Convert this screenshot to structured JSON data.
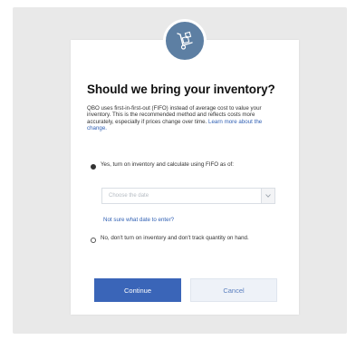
{
  "dialog": {
    "title": "Should we bring your inventory?",
    "description": "QBO uses first-in-first-out (FIFO) instead of average cost to value your inventory. This is the recommended method and reflects costs more accurately, especially if prices change over time.",
    "learn_more_link": "Learn more about the change.",
    "hero_icon": "hand-truck-boxes-icon",
    "options": [
      {
        "label": "Yes, turn on inventory and calculate using FIFO as of:",
        "selected": true
      },
      {
        "label": "No, don't turn on inventory and don't track quantity on hand.",
        "selected": false
      }
    ],
    "date_select": {
      "placeholder": "Choose the date",
      "value": ""
    },
    "help_link": "Not sure what date to enter?",
    "continue_label": "Continue",
    "cancel_label": "Cancel"
  },
  "colors": {
    "primary": "#3a65b8",
    "link": "#2f5fb3",
    "hero": "#5d7fa3",
    "backdrop": "#e9e9e9"
  }
}
